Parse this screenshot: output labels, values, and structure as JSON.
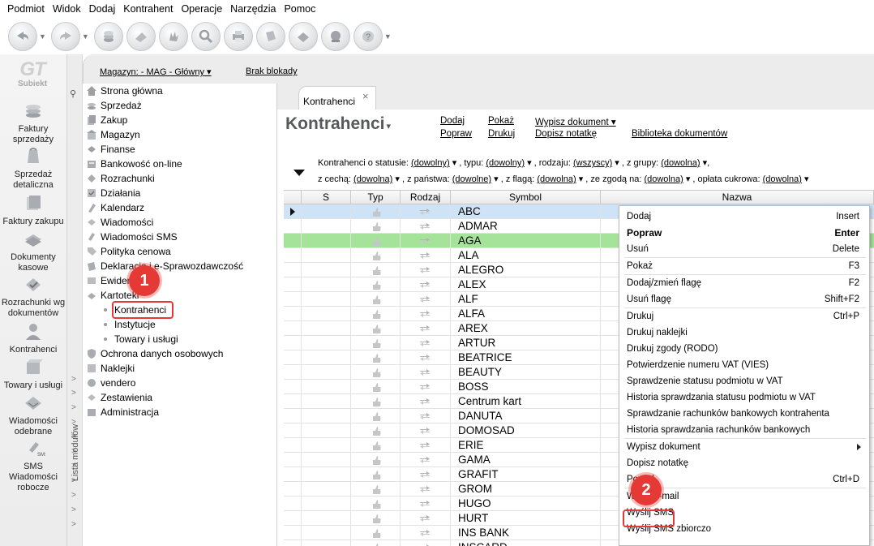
{
  "menubar": [
    "Podmiot",
    "Widok",
    "Dodaj",
    "Kontrahent",
    "Operacje",
    "Narzędzia",
    "Pomoc"
  ],
  "logo": {
    "text": "GT",
    "sub": "Subiekt"
  },
  "leftbar": [
    {
      "label": "Faktury sprzedaży",
      "icon": "invoices-icon"
    },
    {
      "label": "Sprzedaż detaliczna",
      "icon": "retail-icon"
    },
    {
      "label": "Faktury zakupu",
      "icon": "purchase-invoices-icon"
    },
    {
      "label": "Dokumenty kasowe",
      "icon": "cash-documents-icon"
    },
    {
      "label": "Rozrachunki wg dokumentów",
      "icon": "settlements-icon"
    },
    {
      "label": "Kontrahenci",
      "icon": "contractors-icon"
    },
    {
      "label": "Towary i usługi",
      "icon": "goods-icon"
    },
    {
      "label": "Wiadomości odebrane",
      "icon": "inbox-icon"
    },
    {
      "label": "SMS Wiadomości robocze",
      "icon": "sms-draft-icon"
    }
  ],
  "modstrip": {
    "label": "Lista modułów"
  },
  "infobar": {
    "magazyn": "Magazyn: - MAG - Główny",
    "blokada": "Brak blokady"
  },
  "tree": [
    "Strona główna",
    "Sprzedaż",
    "Zakup",
    "Magazyn",
    "Finanse",
    "Bankowość on-line",
    "Rozrachunki",
    "Działania",
    "Kalendarz",
    "Wiadomości",
    "Wiadomości SMS",
    "Polityka cenowa",
    "Deklaracje i e-Sprawozdawczość",
    "Ewidencje",
    "Kartoteki"
  ],
  "tree_sub": [
    "Kontrahenci",
    "Instytucje",
    "Towary i usługi"
  ],
  "tree_after": [
    "Ochrona danych osobowych",
    "Naklejki",
    "vendero",
    "Zestawienia",
    "Administracja"
  ],
  "badges": {
    "one": "1",
    "two": "2"
  },
  "tab": {
    "label": "Kontrahenci",
    "close": "×"
  },
  "title": "Kontrahenci",
  "actions": {
    "dodaj": "Dodaj",
    "popraw": "Popraw",
    "pokaz": "Pokaż",
    "drukuj": "Drukuj",
    "wypisz": "Wypisz dokument",
    "dopisz": "Dopisz notatkę",
    "biblioteka": "Biblioteka dokumentów"
  },
  "filters": {
    "status_label": "Kontrahenci o statusie:",
    "status_val": "(dowolny)",
    "typ_label": ", typu:",
    "typ_val": "(dowolny)",
    "rodzaj_label": ", rodzaju:",
    "rodzaj_val": "(wszyscy)",
    "grupa_label": ", z grupy:",
    "grupa_val": "(dowolna)",
    "tail1": ",",
    "cecha_label": "z cechą:",
    "cecha_val": "(dowolna)",
    "panstwo_label": ", z państwa:",
    "panstwo_val": "(dowolne)",
    "flaga_label": ", z flagą:",
    "flaga_val": "(dowolna)",
    "zgoda_label": ", ze zgodą na:",
    "zgoda_val": "(dowolna)",
    "oplata_label": ", opłata cukrowa:",
    "oplata_val": "(dowolna)"
  },
  "columns": [
    "S",
    "Typ",
    "Rodzaj",
    "Symbol",
    "Nazwa"
  ],
  "rows": [
    "ABC",
    "ADMAR",
    "AGA",
    "ALA",
    "ALEGRO",
    "ALEX",
    "ALF",
    "ALFA",
    "AREX",
    "ARTUR",
    "BEATRICE",
    "BEAUTY",
    "BOSS",
    "Centrum kart",
    "DANUTA",
    "DOMOSAD",
    "ERIE",
    "GAMA",
    "GRAFIT",
    "GROM",
    "HUGO",
    "HURT",
    "INS BANK",
    "INSCARD"
  ],
  "context_menu": [
    {
      "label": "Dodaj",
      "shortcut": "Insert"
    },
    {
      "label": "Popraw",
      "shortcut": "Enter",
      "bold": true
    },
    {
      "label": "Usuń",
      "shortcut": "Delete"
    },
    {
      "sep": true
    },
    {
      "label": "Pokaż",
      "shortcut": "F3"
    },
    {
      "sep": true
    },
    {
      "label": "Dodaj/zmień flagę",
      "shortcut": "F2"
    },
    {
      "label": "Usuń flagę",
      "shortcut": "Shift+F2"
    },
    {
      "sep": true
    },
    {
      "label": "Drukuj",
      "shortcut": "Ctrl+P"
    },
    {
      "label": "Drukuj naklejki",
      "shortcut": ""
    },
    {
      "label": "Drukuj zgody (RODO)",
      "shortcut": ""
    },
    {
      "label": "Potwierdzenie numeru VAT (VIES)",
      "shortcut": ""
    },
    {
      "label": "Sprawdzenie statusu podmiotu w VAT",
      "shortcut": ""
    },
    {
      "label": "Historia sprawdzania statusu podmiotu w VAT",
      "shortcut": ""
    },
    {
      "label": "Sprawdzanie rachunków bankowych kontrahenta",
      "shortcut": ""
    },
    {
      "label": "Historia sprawdzania rachunków bankowych",
      "shortcut": ""
    },
    {
      "sep": true
    },
    {
      "label": "Wypisz dokument",
      "shortcut": "",
      "submenu": true
    },
    {
      "label": "Dopisz notatkę",
      "shortcut": ""
    },
    {
      "label": "Powiel",
      "shortcut": "Ctrl+D"
    },
    {
      "sep": true
    },
    {
      "label": "Wyślij e-mail",
      "shortcut": ""
    },
    {
      "label": "Wyślij SMS",
      "shortcut": ""
    },
    {
      "label": "Wyślij SMS zbiorczo",
      "shortcut": ""
    }
  ],
  "colors": {
    "selected_row": "#cfe3f7",
    "green_row": "#a6e39a",
    "highlight": "#e53935"
  }
}
